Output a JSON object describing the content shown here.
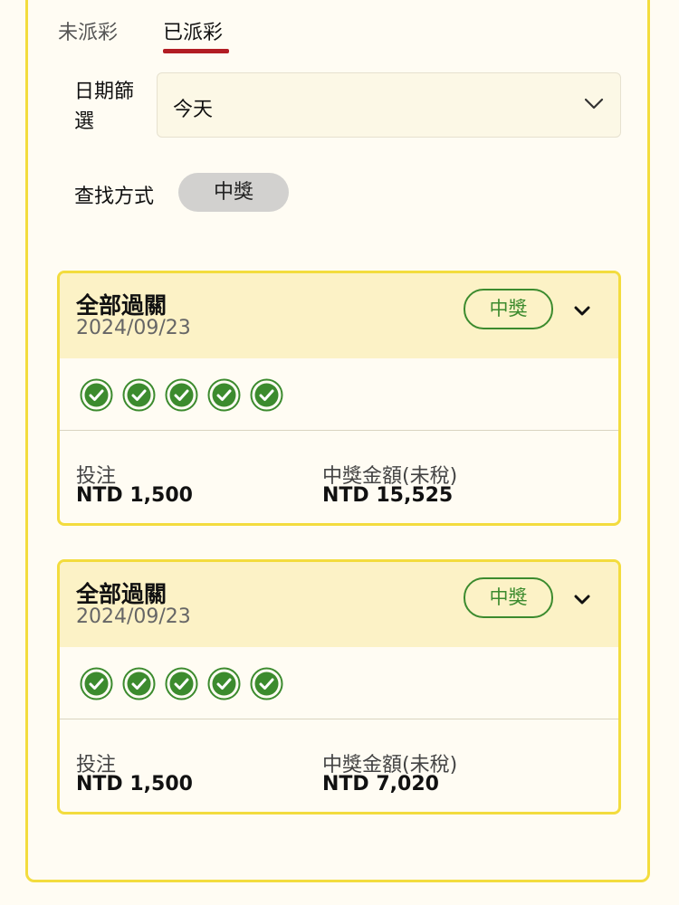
{
  "tabs": [
    {
      "label": "未派彩",
      "active": false
    },
    {
      "label": "已派彩",
      "active": true
    }
  ],
  "date_filter": {
    "label": "日期篩選",
    "value": "今天",
    "icon": "chevron-down-icon"
  },
  "search": {
    "label": "查找方式",
    "chip": "中獎"
  },
  "colors": {
    "accent_border": "#f3dc3e",
    "active_tab_underline": "#b21d24",
    "win_green": "#3c8b2e",
    "card_header_bg": "#fcf2c6"
  },
  "bets": [
    {
      "title": "全部過關",
      "date": "2024/09/23",
      "status": "中獎",
      "legs_won": 5,
      "stake_label": "投注",
      "stake": "NTD 1,500",
      "payout_label": "中獎金額(未稅)",
      "payout": "NTD 15,525"
    },
    {
      "title": "全部過關",
      "date": "2024/09/23",
      "status": "中獎",
      "legs_won": 5,
      "stake_label": "投注",
      "stake": "NTD 1,500",
      "payout_label": "中獎金額(未稅)",
      "payout": "NTD 7,020"
    }
  ]
}
